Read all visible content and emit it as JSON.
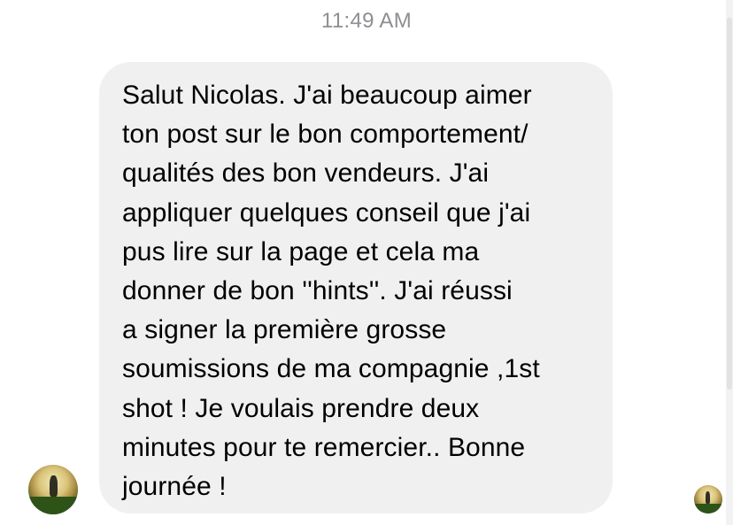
{
  "conversation": {
    "timestamp": "11:49 AM",
    "message": {
      "text": "Salut Nicolas. J'ai beaucoup aimer\nton post sur le bon comportement/\nqualités des bon vendeurs. J'ai\nappliquer quelques conseil que j'ai\npus lire sur la page et cela ma\ndonner de bon ''hints''. J'ai réussi\na signer la première grosse\nsoumissions de ma compagnie ,1st\nshot ! Je voulais prendre deux\nminutes pour te remercier.. Bonne\njournée !",
      "bubble_color": "#f0f0f0",
      "text_color": "#000000"
    },
    "sender_avatar": "profile-photo",
    "read_receipt_avatar": "profile-photo-small"
  },
  "colors": {
    "timestamp": "#8e8e93",
    "background": "#ffffff"
  }
}
